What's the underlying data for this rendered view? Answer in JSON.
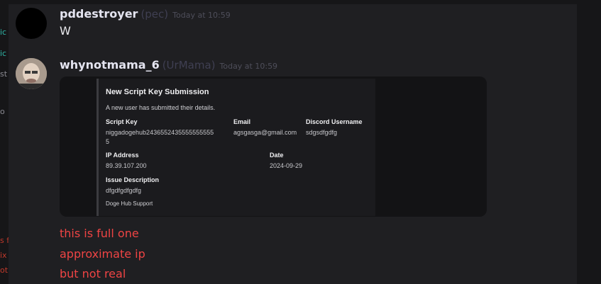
{
  "sidebar_fragments": {
    "a": "ic",
    "b": "ic",
    "c": "st",
    "d": "o",
    "e": "s f",
    "f": "ix",
    "g": "ot"
  },
  "messages": [
    {
      "username": "pddestroyer",
      "nickname": "(pec)",
      "timestamp": "Today at 10:59",
      "text": "W"
    },
    {
      "username": "whynotmama_6",
      "nickname": "(UrMama)",
      "timestamp": "Today at 10:59",
      "embed": {
        "title": "New Script Key Submission",
        "description": "A new user has submitted their details.",
        "fields": {
          "script_key_label": "Script Key",
          "script_key_value_1": "niggadogehub2436552435555555555",
          "script_key_value_2": "5",
          "email_label": "Email",
          "email_value": "agsgasga@gmail.com",
          "discord_label": "Discord Username",
          "discord_value": "sdgsdfgdfg",
          "ip_label": "IP Address",
          "ip_value": "89.39.107.200",
          "date_label": "Date",
          "date_value": "2024-09-29",
          "issue_label": "Issue Description",
          "issue_value": "dfgdfgdfgdfg"
        },
        "footer": "Doge Hub Support"
      },
      "follow_up": [
        "this is full one",
        "approximate ip",
        "but not real"
      ]
    }
  ],
  "colors": {
    "background": "#1f1f22",
    "accent_red": "#ef4444",
    "sidebar_teal": "#2fb6a8"
  }
}
